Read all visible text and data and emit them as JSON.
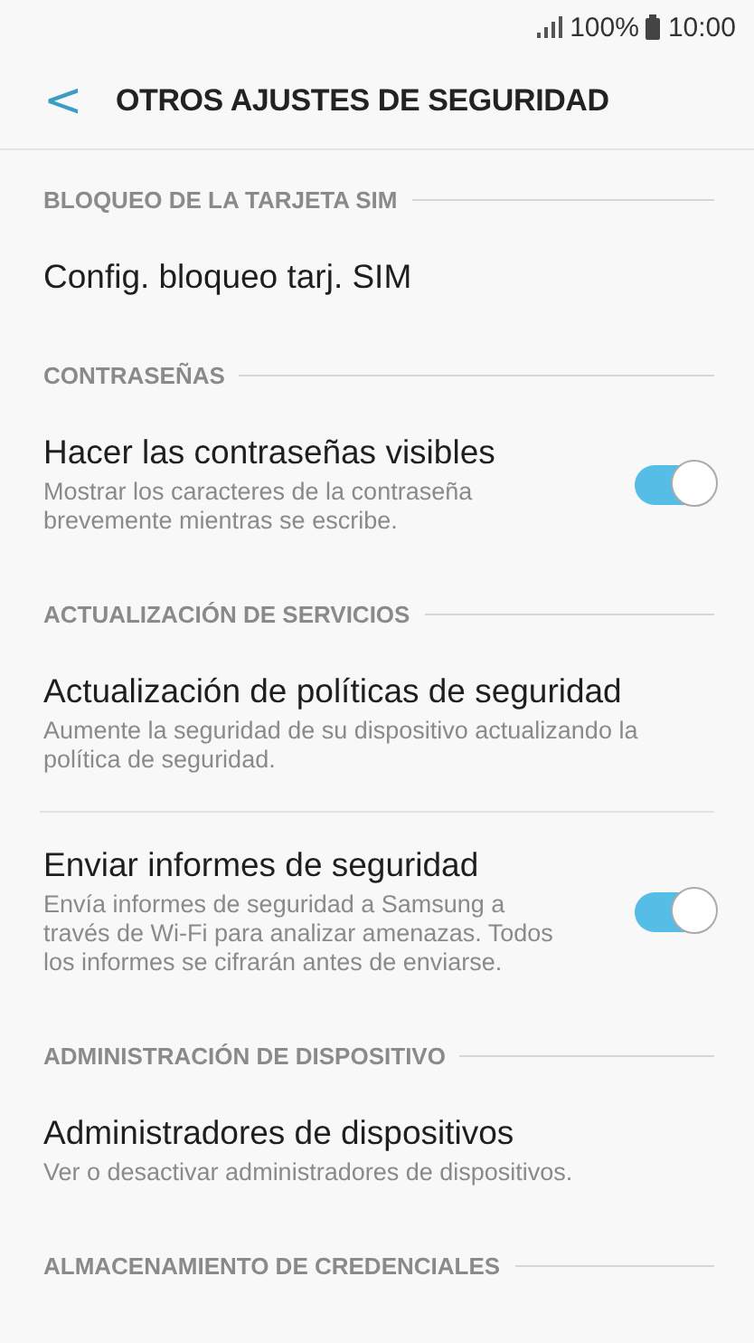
{
  "status_bar": {
    "battery": "100%",
    "time": "10:00"
  },
  "header": {
    "back": "<",
    "title": "OTROS AJUSTES DE SEGURIDAD"
  },
  "sections": [
    {
      "title": "BLOQUEO DE LA TARJETA SIM",
      "items": [
        {
          "kind": "plain",
          "title": "Config. bloqueo tarj. SIM"
        }
      ]
    },
    {
      "title": "CONTRASEÑAS",
      "items": [
        {
          "kind": "switch",
          "title": "Hacer las contraseñas visibles",
          "subtitle": "Mostrar los caracteres de la contraseña brevemente mientras se escribe.",
          "on": true
        }
      ]
    },
    {
      "title": "ACTUALIZACIÓN DE SERVICIOS",
      "items": [
        {
          "kind": "plain",
          "title": "Actualización de políticas de seguridad",
          "subtitle": "Aumente la seguridad de su dispositivo actualizando la política de seguridad."
        },
        {
          "kind": "switch",
          "title": "Enviar informes de seguridad",
          "subtitle": "Envía informes de seguridad a Samsung a través de Wi-Fi para analizar amenazas. Todos los informes se cifrarán antes de enviarse.",
          "on": true
        }
      ]
    },
    {
      "title": "ADMINISTRACIÓN DE DISPOSITIVO",
      "items": [
        {
          "kind": "plain",
          "title": "Administradores de dispositivos",
          "subtitle": "Ver o desactivar administradores de dispositivos."
        }
      ]
    },
    {
      "title": "ALMACENAMIENTO DE CREDENCIALES"
    }
  ]
}
